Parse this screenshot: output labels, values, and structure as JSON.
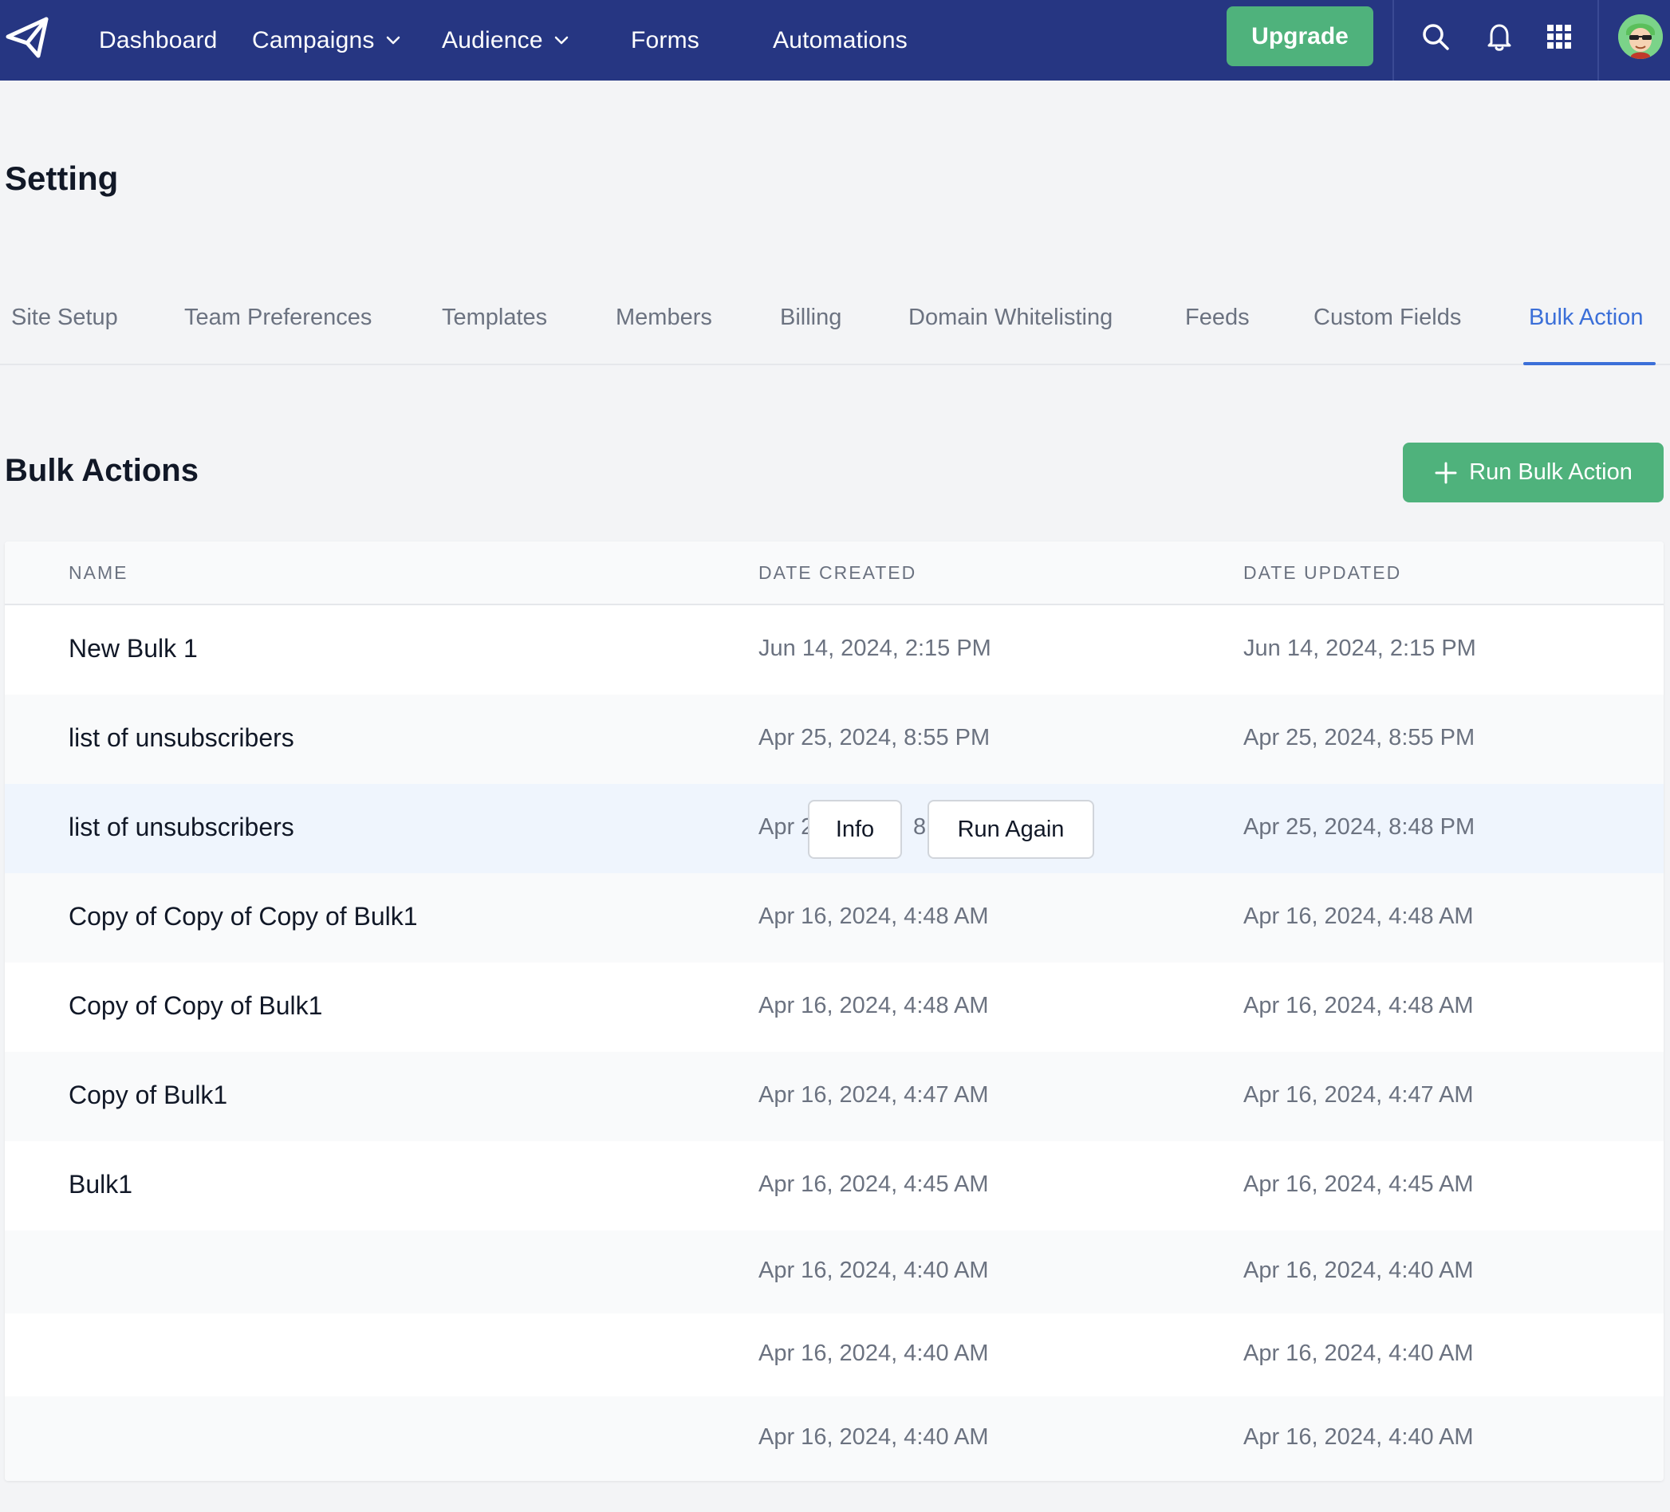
{
  "nav": {
    "items": [
      {
        "label": "Dashboard"
      },
      {
        "label": "Campaigns"
      },
      {
        "label": "Audience"
      },
      {
        "label": "Forms"
      },
      {
        "label": "Automations"
      }
    ],
    "upgrade_label": "Upgrade",
    "brand_color": "#263682",
    "accent_green": "#4fb27c"
  },
  "page": {
    "title": "Setting"
  },
  "tabs": [
    {
      "label": "Site Setup"
    },
    {
      "label": "Team Preferences"
    },
    {
      "label": "Templates"
    },
    {
      "label": "Members"
    },
    {
      "label": "Billing"
    },
    {
      "label": "Domain Whitelisting"
    },
    {
      "label": "Feeds"
    },
    {
      "label": "Custom Fields"
    },
    {
      "label": "Bulk Action",
      "active": true
    }
  ],
  "section": {
    "title": "Bulk Actions",
    "run_button_label": "Run Bulk Action"
  },
  "table": {
    "columns": [
      "NAME",
      "DATE CREATED",
      "DATE UPDATED"
    ],
    "rows": [
      {
        "name": "New Bulk 1",
        "created": "Jun 14, 2024, 2:15 PM",
        "updated": "Jun 14, 2024, 2:15 PM"
      },
      {
        "name": "list of unsubscribers",
        "created": "Apr 25, 2024, 8:55 PM",
        "updated": "Apr 25, 2024, 8:55 PM"
      },
      {
        "name": "list of unsubscribers",
        "created": "Apr 2",
        "created_tail": "8:",
        "updated": "Apr 25, 2024, 8:48 PM",
        "hover": true
      },
      {
        "name": "Copy of Copy of Copy of Bulk1",
        "created": "Apr 16, 2024, 4:48 AM",
        "updated": "Apr 16, 2024, 4:48 AM"
      },
      {
        "name": "Copy of Copy of Bulk1",
        "created": "Apr 16, 2024, 4:48 AM",
        "updated": "Apr 16, 2024, 4:48 AM"
      },
      {
        "name": "Copy of Bulk1",
        "created": "Apr 16, 2024, 4:47 AM",
        "updated": "Apr 16, 2024, 4:47 AM"
      },
      {
        "name": "Bulk1",
        "created": "Apr 16, 2024, 4:45 AM",
        "updated": "Apr 16, 2024, 4:45 AM"
      },
      {
        "name": "",
        "created": "Apr 16, 2024, 4:40 AM",
        "updated": "Apr 16, 2024, 4:40 AM"
      },
      {
        "name": "",
        "created": "Apr 16, 2024, 4:40 AM",
        "updated": "Apr 16, 2024, 4:40 AM"
      },
      {
        "name": "",
        "created": "Apr 16, 2024, 4:40 AM",
        "updated": "Apr 16, 2024, 4:40 AM"
      }
    ],
    "row_actions": {
      "info_label": "Info",
      "run_again_label": "Run Again"
    }
  },
  "icons": [
    "paper-plane-logo-icon",
    "chevron-down-icon",
    "search-icon",
    "bell-icon",
    "apps-grid-icon",
    "avatar",
    "plus-icon"
  ]
}
